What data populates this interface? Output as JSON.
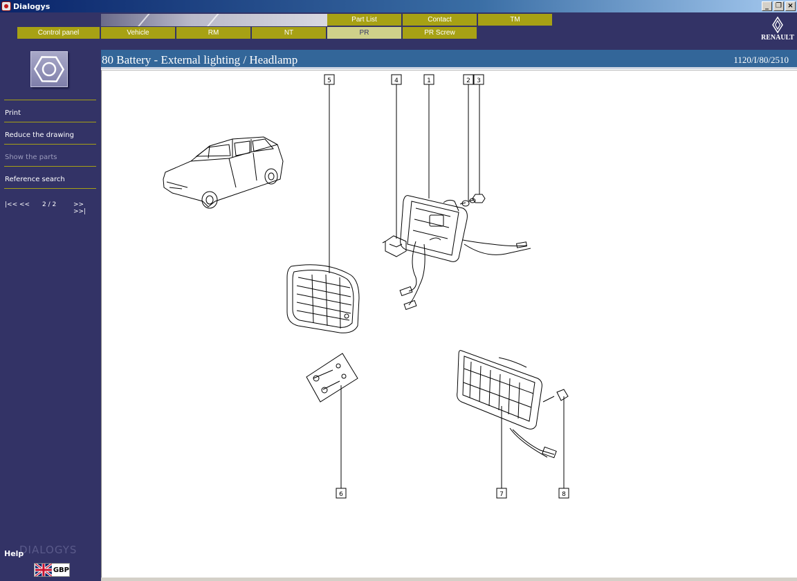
{
  "window": {
    "title": "Dialogys",
    "controls": [
      "_",
      "❐",
      "×"
    ]
  },
  "tabs_top": [
    {
      "label": "Part List"
    },
    {
      "label": "Contact"
    },
    {
      "label": "TM"
    }
  ],
  "tabs_bottom": [
    {
      "label": "Control panel"
    },
    {
      "label": "Vehicle"
    },
    {
      "label": "RM"
    },
    {
      "label": "NT"
    },
    {
      "label": "PR",
      "active": true
    },
    {
      "label": "PR Screw"
    }
  ],
  "brand": {
    "name": "RENAULT"
  },
  "sidebar": {
    "icon": "hex-nut-icon",
    "items": [
      {
        "label": "Print",
        "enabled": true
      },
      {
        "label": "Reduce the drawing",
        "enabled": true
      },
      {
        "label": "Show the parts",
        "enabled": false
      },
      {
        "label": "Reference search",
        "enabled": true
      }
    ],
    "pager": {
      "first_prev": "|<< <<",
      "page": "2 / 2",
      "next_last": ">> >>|"
    },
    "help": "Help",
    "watermark": "DIALOGYS",
    "language": {
      "code": "GBP",
      "flag": "uk-flag-icon"
    }
  },
  "page": {
    "title": "80 Battery - External lighting / Headlamp",
    "reference": "1120/I/80/2510"
  },
  "drawing": {
    "callouts": [
      "1",
      "2",
      "3",
      "4",
      "5",
      "6",
      "7",
      "8"
    ]
  },
  "colors": {
    "navy": "#333366",
    "olive_tab": "#a7a114",
    "active_tab": "#cfd08a",
    "header_blue": "#336699"
  }
}
